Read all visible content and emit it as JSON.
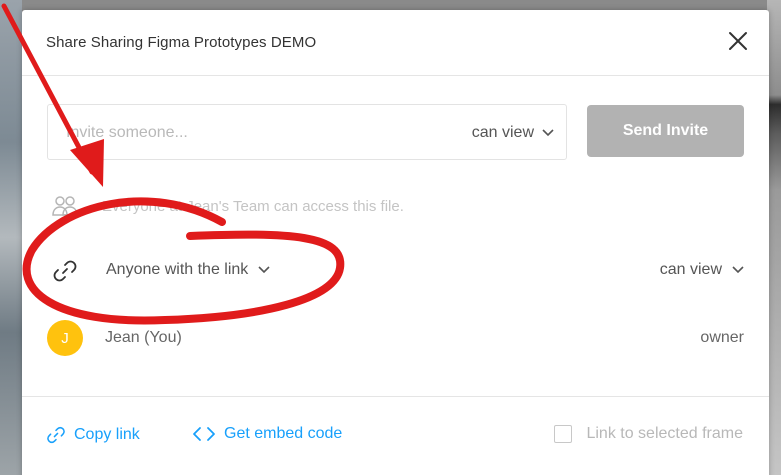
{
  "dialog": {
    "title": "Share Sharing Figma Prototypes DEMO"
  },
  "invite": {
    "placeholder": "Invite someone...",
    "permission": "can view",
    "send_label": "Send Invite"
  },
  "team": {
    "text": "Everyone at Jean's Team can access this file."
  },
  "link": {
    "access_label": "Anyone with the link",
    "permission": "can view"
  },
  "user": {
    "initial": "J",
    "name": "Jean (You)",
    "role": "owner"
  },
  "footer": {
    "copy_link": "Copy link",
    "embed_code": "Get embed code",
    "frame_option": "Link to selected frame"
  },
  "colors": {
    "accent": "#18a0fb",
    "annotation": "#e01b1b",
    "avatar": "#ffc20e",
    "send_button": "#b2b2b2"
  },
  "icons": {
    "close": "close-icon",
    "chevron": "chevron-down-icon",
    "team": "people-icon",
    "link": "link-icon",
    "embed": "code-icon"
  }
}
